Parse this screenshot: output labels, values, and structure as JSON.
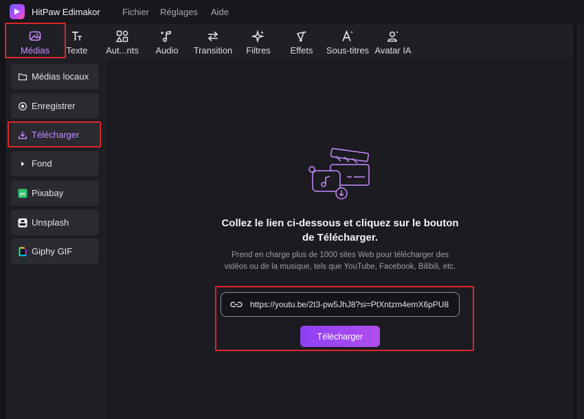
{
  "app": {
    "title": "HitPaw Edimakor"
  },
  "menu": [
    "Fichier",
    "Réglages",
    "Aide"
  ],
  "toolbar": [
    {
      "label": "Médias",
      "icon": "media-icon",
      "active": true
    },
    {
      "label": "Texte",
      "icon": "text-icon"
    },
    {
      "label": "Aut...nts",
      "icon": "elements-icon"
    },
    {
      "label": "Audio",
      "icon": "audio-icon"
    },
    {
      "label": "Transition",
      "icon": "transition-icon"
    },
    {
      "label": "Filtres",
      "icon": "filter-icon"
    },
    {
      "label": "Effets",
      "icon": "effects-icon"
    },
    {
      "label": "Sous-titres",
      "icon": "subtitles-icon"
    },
    {
      "label": "Avatar IA",
      "icon": "avatar-icon"
    }
  ],
  "sidebar": [
    {
      "label": "Médias locaux",
      "icon": "folder-icon"
    },
    {
      "label": "Enregistrer",
      "icon": "record-icon"
    },
    {
      "label": "Télécharger",
      "icon": "download-icon",
      "active": true
    },
    {
      "label": "Fond",
      "icon": "caret-right-icon"
    },
    {
      "label": "Pixabay",
      "icon": "pixabay-icon"
    },
    {
      "label": "Unsplash",
      "icon": "unsplash-icon"
    },
    {
      "label": "Giphy GIF",
      "icon": "giphy-icon"
    }
  ],
  "main": {
    "headline": "Collez le lien ci-dessous et cliquez sur le bouton de Télécharger.",
    "subtext": "Prend en charge plus de 1000 sites Web pour télécharger des vidéos ou de la musique, tels que YouTube, Facebook, Bilibili, etc.",
    "url_value": "https://youtu.be/2t3-pw5JhJ8?si=PtXntzm4emX6pPU8",
    "download_button": "Télécharger"
  },
  "colors": {
    "accent": "#b04ef0",
    "highlight_box": "#e0262b",
    "active_text": "#c78cff"
  }
}
